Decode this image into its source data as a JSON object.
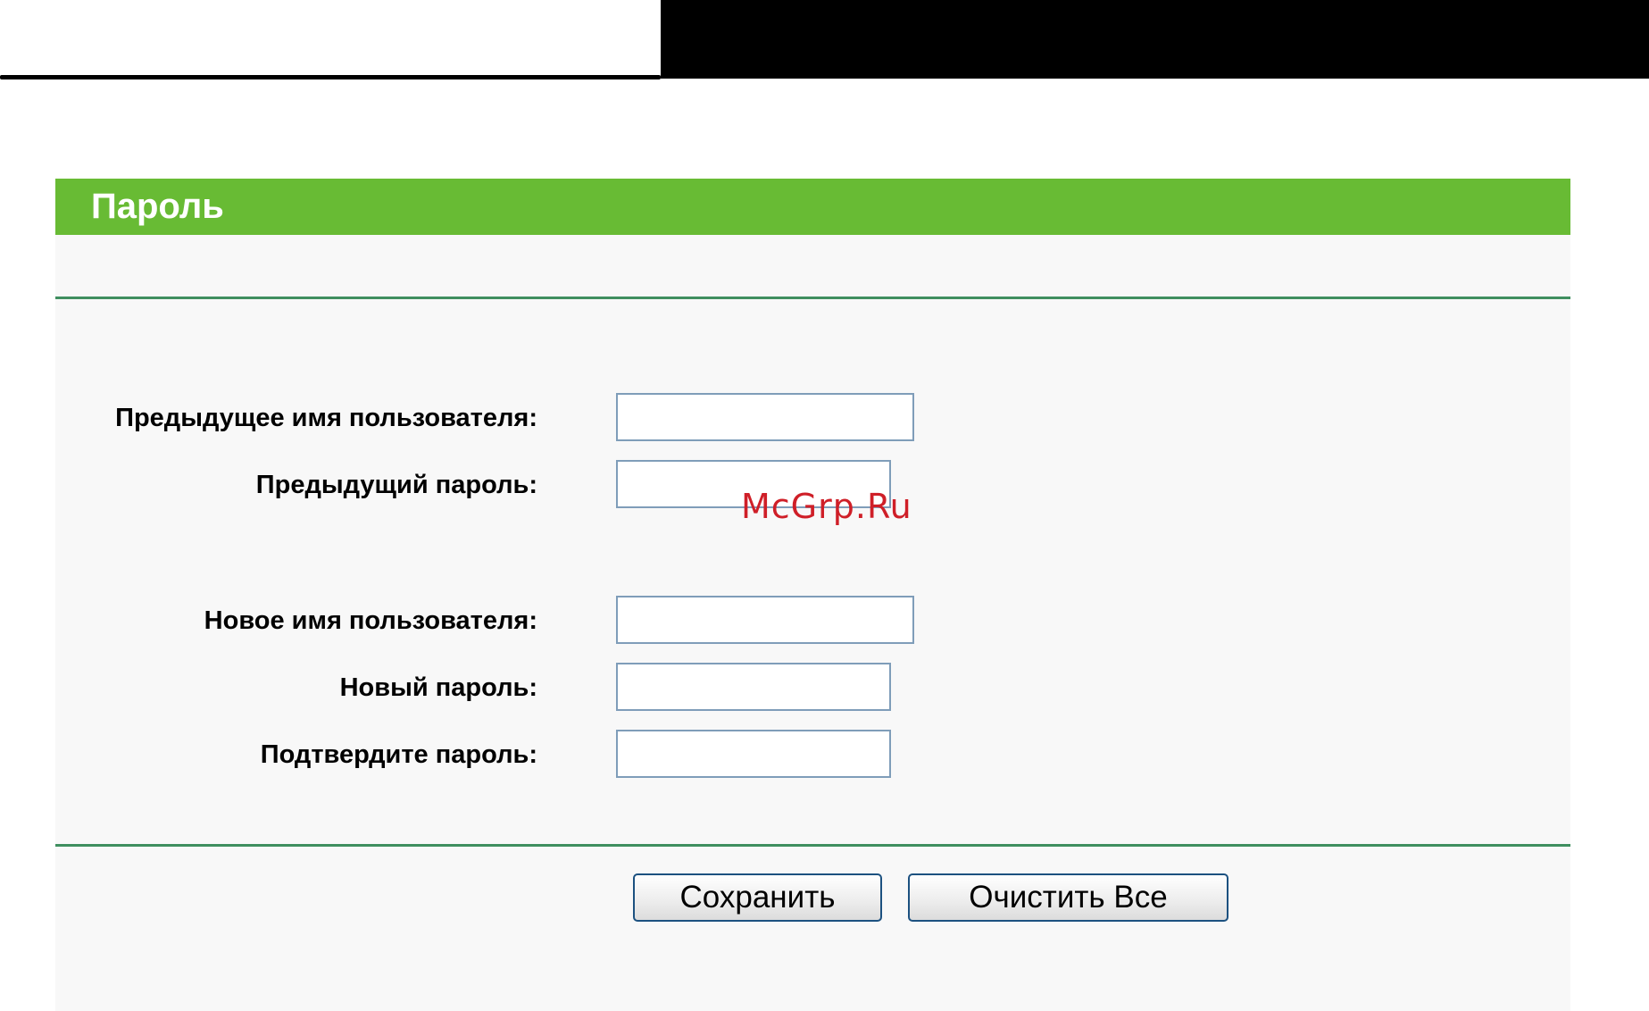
{
  "panel": {
    "title": "Пароль"
  },
  "form": {
    "old_username": {
      "label": "Предыдущее имя пользователя:",
      "value": ""
    },
    "old_password": {
      "label": "Предыдущий пароль:",
      "value": ""
    },
    "new_username": {
      "label": "Новое имя пользователя:",
      "value": ""
    },
    "new_password": {
      "label": "Новый пароль:",
      "value": ""
    },
    "confirm_password": {
      "label": "Подтвердите пароль:",
      "value": ""
    }
  },
  "buttons": {
    "save": "Сохранить",
    "clear_all": "Очистить Все"
  },
  "watermark": "McGrp.Ru",
  "colors": {
    "header_green": "#68bb34",
    "divider_green": "#3f8f5f",
    "input_border": "#7f9db9",
    "button_border": "#1c5180",
    "watermark_red": "#cf1f28"
  }
}
